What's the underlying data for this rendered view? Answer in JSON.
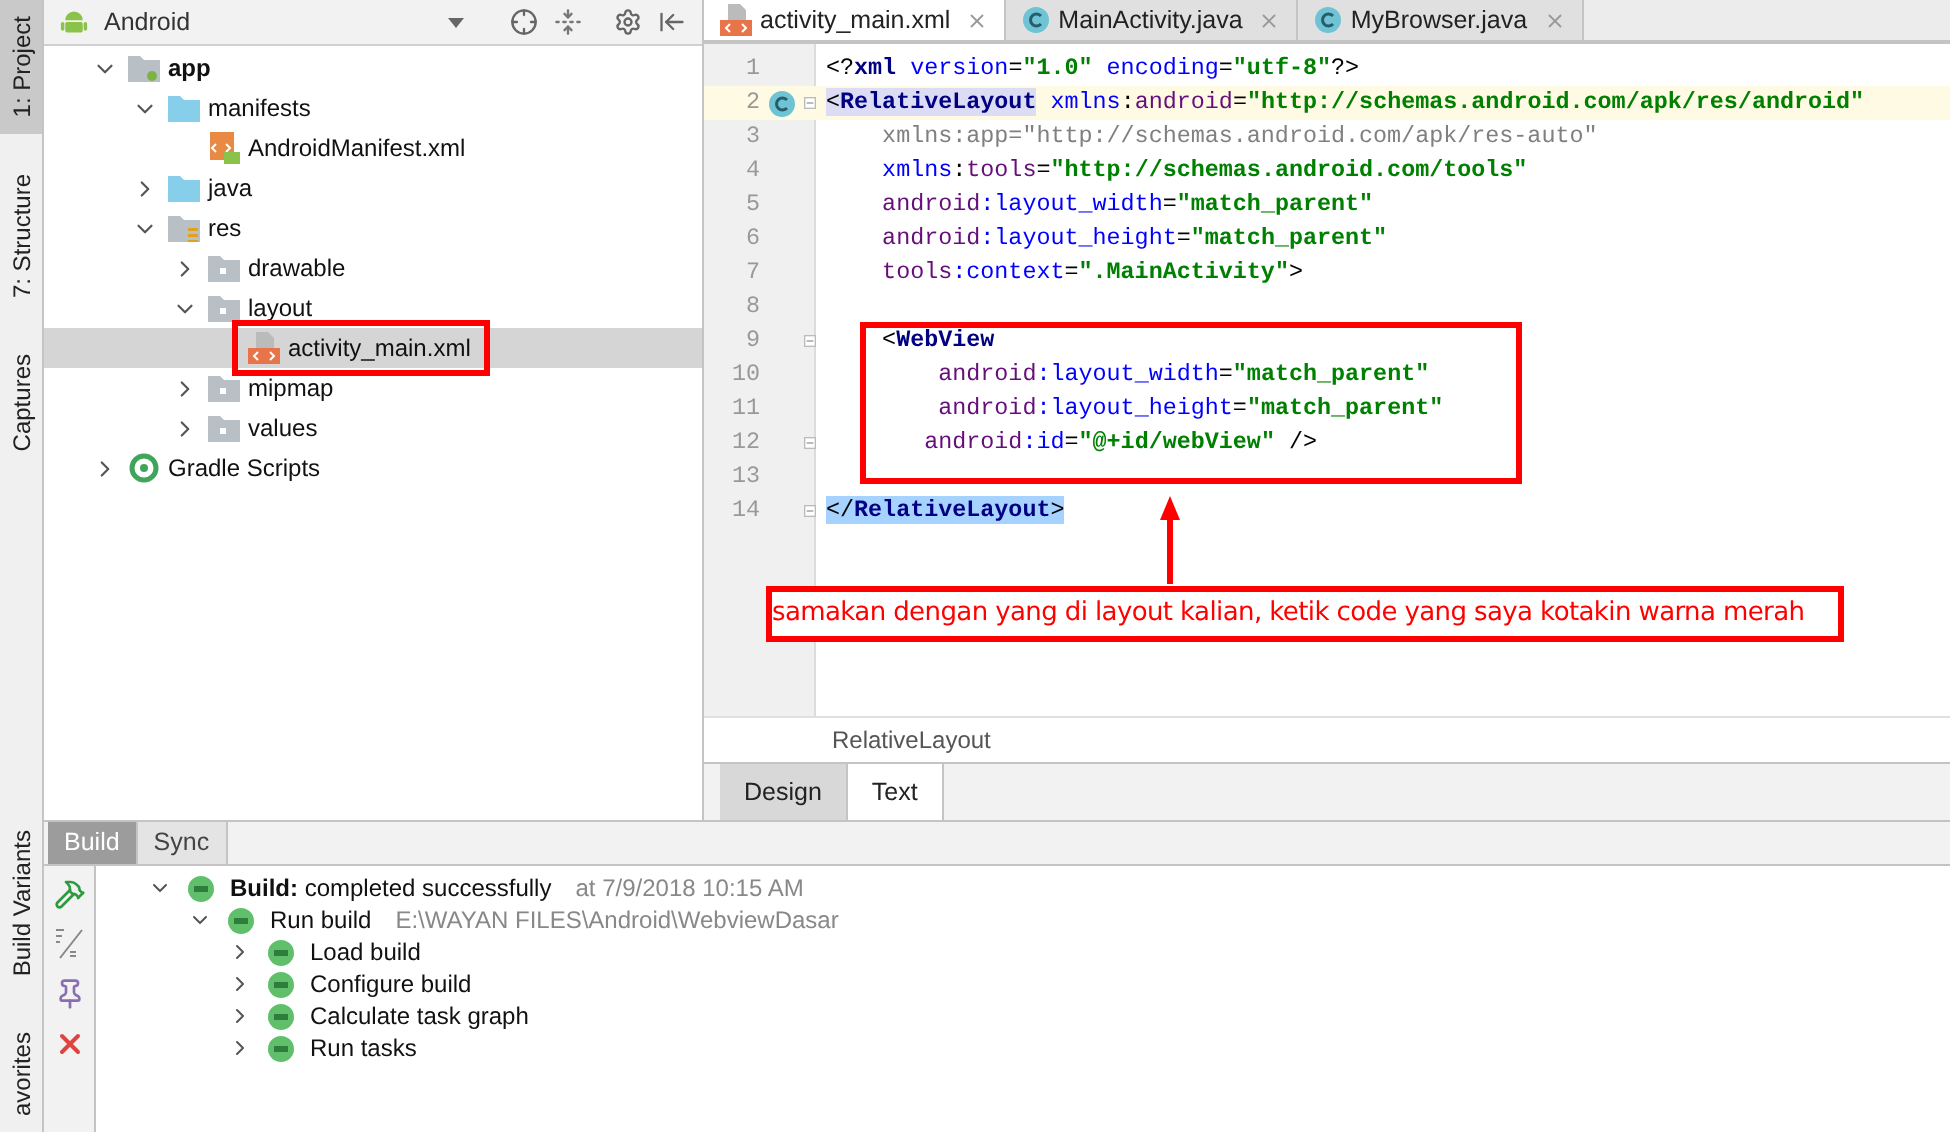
{
  "side_strip": {
    "top": [
      {
        "label": "1: Project",
        "selected": true
      },
      {
        "label": "7: Structure",
        "selected": false
      },
      {
        "label": "Captures",
        "selected": false
      }
    ],
    "bottom": [
      {
        "label": "Build Variants",
        "selected": false
      },
      {
        "label": "avorites",
        "selected": false
      }
    ]
  },
  "project": {
    "view": "Android",
    "tree": [
      {
        "label": "app",
        "kind": "module",
        "expanded": true,
        "selected": false,
        "children": [
          {
            "label": "manifests",
            "kind": "folder",
            "expanded": true,
            "selected": false,
            "children": [
              {
                "label": "AndroidManifest.xml",
                "kind": "manifest",
                "selected": false
              }
            ]
          },
          {
            "label": "java",
            "kind": "folder",
            "expanded": false,
            "selected": false
          },
          {
            "label": "res",
            "kind": "res",
            "expanded": true,
            "selected": false,
            "children": [
              {
                "label": "drawable",
                "kind": "dir",
                "expanded": false,
                "selected": false
              },
              {
                "label": "layout",
                "kind": "dir",
                "expanded": true,
                "selected": false,
                "children": [
                  {
                    "label": "activity_main.xml",
                    "kind": "xml",
                    "selected": true,
                    "annotated": true
                  }
                ]
              },
              {
                "label": "mipmap",
                "kind": "dir",
                "expanded": false,
                "selected": false
              },
              {
                "label": "values",
                "kind": "dir",
                "expanded": false,
                "selected": false
              }
            ]
          }
        ]
      },
      {
        "label": "Gradle Scripts",
        "kind": "gradle",
        "expanded": false,
        "selected": false
      }
    ]
  },
  "editor": {
    "tabs": [
      {
        "label": "activity_main.xml",
        "kind": "xml",
        "selected": true
      },
      {
        "label": "MainActivity.java",
        "kind": "class",
        "selected": false
      },
      {
        "label": "MyBrowser.java",
        "kind": "class",
        "selected": false
      }
    ],
    "lines": [
      {
        "number": "1",
        "current": false,
        "marker": false,
        "fold": false,
        "tokens": [
          {
            "t": "<?",
            "kind": "punct"
          },
          {
            "t": "xml",
            "kind": "tag"
          },
          {
            "t": " version",
            "kind": "attr"
          },
          {
            "t": "=",
            "kind": "punct"
          },
          {
            "t": "\"1.0\"",
            "kind": "value"
          },
          {
            "t": " encoding",
            "kind": "attr"
          },
          {
            "t": "=",
            "kind": "punct"
          },
          {
            "t": "\"utf-8\"",
            "kind": "value"
          },
          {
            "t": "?>",
            "kind": "punct"
          }
        ]
      },
      {
        "number": "2",
        "current": true,
        "marker": true,
        "fold": true,
        "tokens": [
          {
            "t": "<",
            "kind": "punct",
            "matched": true
          },
          {
            "t": "RelativeLayout",
            "kind": "tag",
            "matched": true
          },
          {
            "t": " xmlns",
            "kind": "attr"
          },
          {
            "t": ":",
            "kind": "punct"
          },
          {
            "t": "android",
            "kind": "ns"
          },
          {
            "t": "=",
            "kind": "punct"
          },
          {
            "t": "\"http://schemas.android.com/apk/res/android\"",
            "kind": "value"
          }
        ]
      },
      {
        "number": "3",
        "current": false,
        "marker": false,
        "fold": false,
        "tokens": [
          {
            "t": "    xmlns:app=\"http://schemas.android.com/apk/res-auto\"",
            "kind": "unused"
          }
        ]
      },
      {
        "number": "4",
        "current": false,
        "marker": false,
        "fold": false,
        "tokens": [
          {
            "t": "    xmlns",
            "kind": "attr"
          },
          {
            "t": ":",
            "kind": "punct"
          },
          {
            "t": "tools",
            "kind": "ns"
          },
          {
            "t": "=",
            "kind": "punct"
          },
          {
            "t": "\"http://schemas.android.com/tools\"",
            "kind": "value"
          }
        ]
      },
      {
        "number": "5",
        "current": false,
        "marker": false,
        "fold": false,
        "tokens": [
          {
            "t": "    android",
            "kind": "ns"
          },
          {
            "t": ":layout_width",
            "kind": "attr"
          },
          {
            "t": "=",
            "kind": "punct"
          },
          {
            "t": "\"match_parent\"",
            "kind": "value"
          }
        ]
      },
      {
        "number": "6",
        "current": false,
        "marker": false,
        "fold": false,
        "tokens": [
          {
            "t": "    android",
            "kind": "ns"
          },
          {
            "t": ":layout_height",
            "kind": "attr"
          },
          {
            "t": "=",
            "kind": "punct"
          },
          {
            "t": "\"match_parent\"",
            "kind": "value"
          }
        ]
      },
      {
        "number": "7",
        "current": false,
        "marker": false,
        "fold": false,
        "tokens": [
          {
            "t": "    tools",
            "kind": "ns"
          },
          {
            "t": ":context",
            "kind": "attr"
          },
          {
            "t": "=",
            "kind": "punct"
          },
          {
            "t": "\".MainActivity\"",
            "kind": "value"
          },
          {
            "t": ">",
            "kind": "punct"
          }
        ]
      },
      {
        "number": "8",
        "current": false,
        "marker": false,
        "fold": false
      },
      {
        "number": "9",
        "current": false,
        "marker": false,
        "fold": true,
        "tokens": [
          {
            "t": "    <",
            "kind": "punct"
          },
          {
            "t": "WebView",
            "kind": "tag"
          }
        ]
      },
      {
        "number": "10",
        "current": false,
        "marker": false,
        "fold": false,
        "tokens": [
          {
            "t": "        android",
            "kind": "ns"
          },
          {
            "t": ":layout_width",
            "kind": "attr"
          },
          {
            "t": "=",
            "kind": "punct"
          },
          {
            "t": "\"match_parent\"",
            "kind": "value"
          }
        ]
      },
      {
        "number": "11",
        "current": false,
        "marker": false,
        "fold": false,
        "tokens": [
          {
            "t": "        android",
            "kind": "ns"
          },
          {
            "t": ":layout_height",
            "kind": "attr"
          },
          {
            "t": "=",
            "kind": "punct"
          },
          {
            "t": "\"match_parent\"",
            "kind": "value"
          }
        ]
      },
      {
        "number": "12",
        "current": false,
        "marker": false,
        "fold": true,
        "tokens": [
          {
            "t": "       android",
            "kind": "ns"
          },
          {
            "t": ":id",
            "kind": "attr"
          },
          {
            "t": "=",
            "kind": "punct"
          },
          {
            "t": "\"@+id/webView\"",
            "kind": "value"
          },
          {
            "t": " />",
            "kind": "punct"
          }
        ]
      },
      {
        "number": "13",
        "current": false,
        "marker": false,
        "fold": false
      },
      {
        "number": "14",
        "current": false,
        "marker": false,
        "fold": true,
        "tokens": [
          {
            "t": "</",
            "kind": "punct",
            "selected": true
          },
          {
            "t": "RelativeLayout",
            "kind": "tag",
            "selected": true
          },
          {
            "t": ">",
            "kind": "punct",
            "selected": true
          }
        ]
      }
    ],
    "annotation": {
      "text": "samakan dengan yang di layout kalian, ketik code yang saya kotakin warna merah"
    },
    "breadcrumb": "RelativeLayout",
    "mode_tabs": [
      {
        "label": "Design",
        "selected": false
      },
      {
        "label": "Text",
        "selected": true
      }
    ]
  },
  "build": {
    "tabs": [
      {
        "label": "Build",
        "selected": true
      },
      {
        "label": "Sync",
        "selected": false
      }
    ],
    "tree": [
      {
        "text": "**Build:** completed successfully",
        "detail": "at 7/9/2018 10:15 AM",
        "expanded": true,
        "children": [
          {
            "text": "Run build",
            "detail": "E:\\WAYAN FILES\\Android\\WebviewDasar",
            "expanded": true,
            "children": [
              {
                "text": "Load build",
                "expanded": false
              },
              {
                "text": "Configure build",
                "expanded": false
              },
              {
                "text": "Calculate task graph",
                "expanded": false
              },
              {
                "text": "Run tasks",
                "expanded": false
              }
            ]
          }
        ]
      }
    ]
  }
}
